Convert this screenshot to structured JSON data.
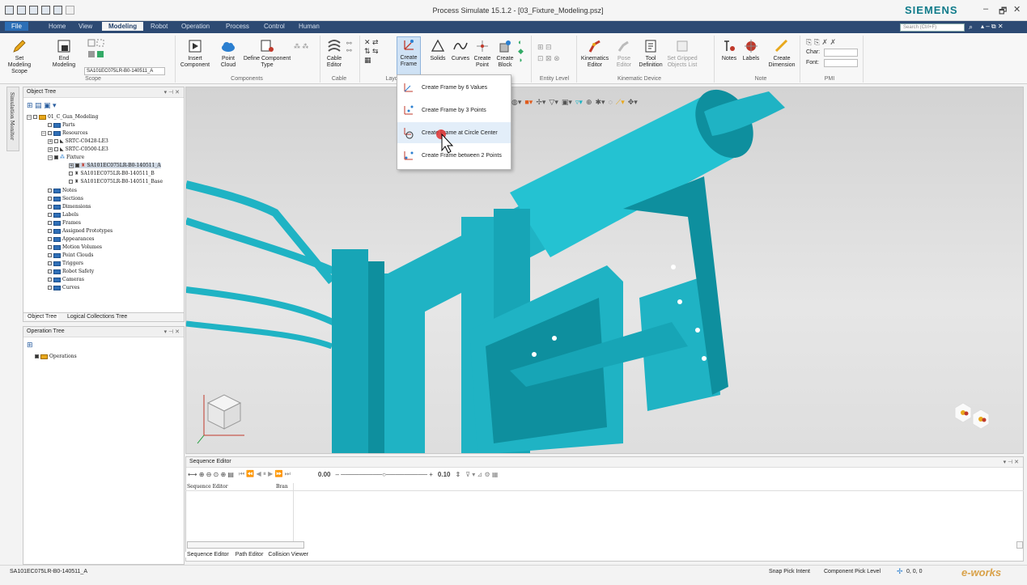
{
  "window": {
    "title": "Process Simulate 15.1.2 - [03_Fixture_Modeling.psz]",
    "brand": "SIEMENS",
    "controls": [
      "–",
      "🗗",
      "✕"
    ]
  },
  "ribbon_tabs": {
    "file": "File",
    "home": "Home",
    "view": "View",
    "modeling": "Modeling",
    "robot": "Robot",
    "operation": "Operation",
    "process": "Process",
    "control": "Control",
    "human": "Human"
  },
  "search": {
    "placeholder": "Search (Ctrl+F)"
  },
  "ribbon": {
    "scope": {
      "set_modeling": "Set Modeling Scope",
      "end_modeling": "End Modeling",
      "component_field": "SA101EC075LR-B0-140511_A",
      "label": "Scope"
    },
    "components": {
      "insert": "Insert Component",
      "point_cloud": "Point Cloud",
      "define_type": "Define Component Type",
      "label": "Components"
    },
    "cable": {
      "editor": "Cable Editor",
      "label": "Cable"
    },
    "layout": {
      "create_frame": "Create Frame",
      "solids": "Solids",
      "curves": "Curves",
      "create_point": "Create Point",
      "create_block": "Create Block",
      "label": "Layout"
    },
    "entity": {
      "label": "Entity Level"
    },
    "kinematic": {
      "editor": "Kinematics Editor",
      "pose_editor": "Pose Editor",
      "tool_definition": "Tool Definition",
      "set_gripped": "Set Gripped Objects List",
      "label": "Kinematic Device"
    },
    "note": {
      "notes": "Notes",
      "labels": "Labels",
      "dimension": "Create Dimension",
      "label": "Note"
    },
    "pmi": {
      "char": "Char:",
      "font": "Font:",
      "label": "PMI"
    }
  },
  "dropdown": {
    "items": [
      "Create Frame by 6 Values",
      "Create Frame by 3 Points",
      "Create Frame at Circle Center",
      "Create Frame between 2 Points"
    ]
  },
  "object_tree": {
    "title": "Object Tree",
    "side_label": "Simulation Monitor",
    "root": "01_C_Gun_Modeling",
    "items": [
      "Parts",
      "Resources",
      "SRTC-C0428-LE3",
      "SRTC-C0500-LE3",
      "Fixture",
      "SA101EC075LR-B0-140511_A",
      "SA101EC075LR-B0-140511_B",
      "SA101EC075LR-B0-140511_Base",
      "Notes",
      "Sections",
      "Dimensions",
      "Labels",
      "Frames",
      "Assigned Prototypes",
      "Appearances",
      "Motion Volumes",
      "Point Clouds",
      "Triggers",
      "Robot Safety",
      "Cameras",
      "Curves"
    ],
    "tabs": [
      "Object Tree",
      "Logical Collections Tree"
    ]
  },
  "operation_tree": {
    "title": "Operation Tree",
    "root": "Operations"
  },
  "sequence_editor": {
    "title": "Sequence Editor",
    "time_value": "0.00",
    "step_value": "0.10",
    "columns": [
      "Sequence Editor",
      "Bran"
    ],
    "tabs": [
      "Sequence Editor",
      "Path Editor",
      "Collision Viewer"
    ]
  },
  "status_bar": {
    "selection": "SA101EC075LR-B0-140511_A",
    "snap": "Snap Pick Intent",
    "pick_level": "Component Pick Level",
    "coords": "0, 0, 0",
    "watermark": "e-works"
  },
  "colors": {
    "model_cyan": "#1fb3c4",
    "model_dark": "#0e7f8e",
    "ribbon_bar": "#2d4a73",
    "brand": "#0f7b8a"
  }
}
